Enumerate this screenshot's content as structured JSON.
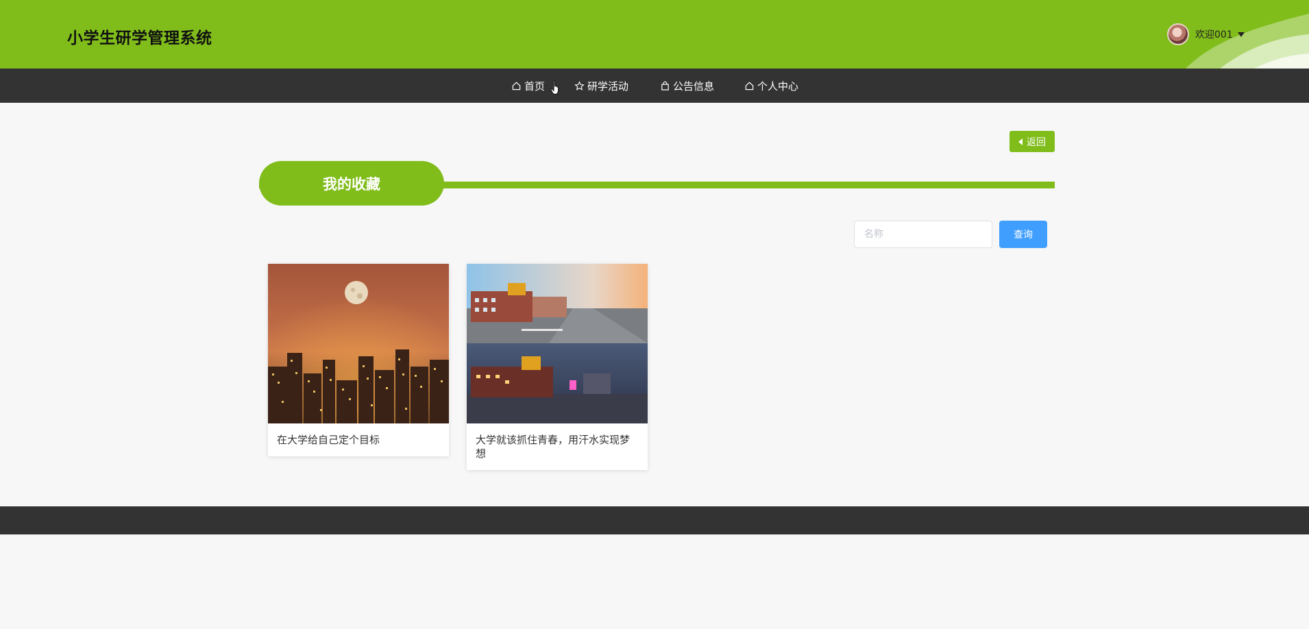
{
  "header": {
    "title": "小学生研学管理系统",
    "welcome": "欢迎001",
    "brand_color": "#80bd1b"
  },
  "nav": {
    "items": [
      {
        "label": "首页",
        "icon": "home-icon"
      },
      {
        "label": "研学活动",
        "icon": "star-icon"
      },
      {
        "label": "公告信息",
        "icon": "bag-icon"
      },
      {
        "label": "个人中心",
        "icon": "home-icon"
      }
    ]
  },
  "main": {
    "back_label": "返回",
    "section_title": "我的收藏",
    "search": {
      "placeholder": "名称",
      "button_label": "查询"
    },
    "cards": [
      {
        "title": "在大学给自己定个目标",
        "image": "city-night-moon"
      },
      {
        "title": "大学就该抓住青春，用汗水实现梦想",
        "image": "campus-building-day-night"
      }
    ]
  },
  "colors": {
    "nav_bg": "#333333",
    "search_button": "#409eff"
  }
}
